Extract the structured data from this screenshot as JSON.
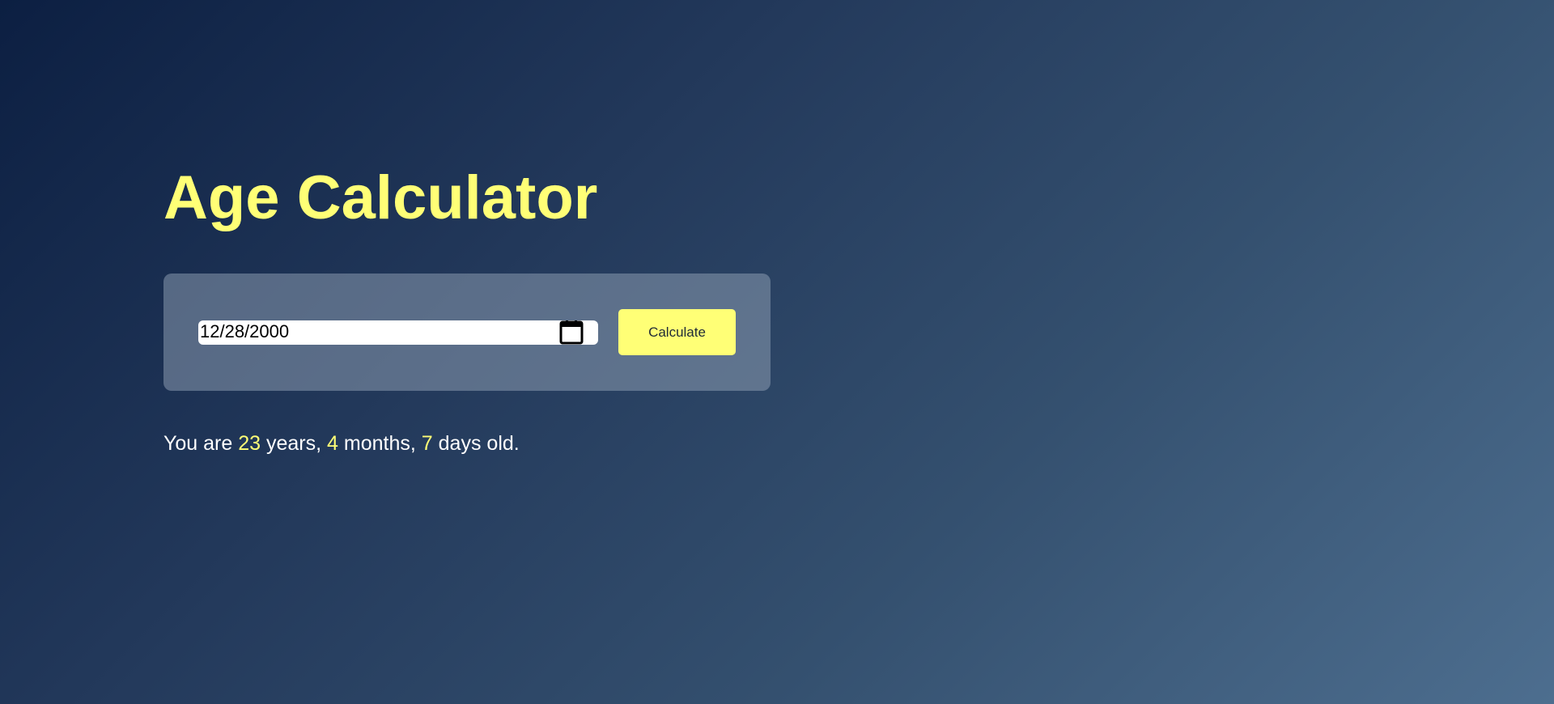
{
  "app": {
    "title": "Age Calculator"
  },
  "form": {
    "date_value": "12/28/2000",
    "button_label": "Calculate",
    "calendar_icon": "calendar-icon"
  },
  "result": {
    "prefix": "You are",
    "years": "23",
    "years_label": "years,",
    "months": "4",
    "months_label": "months,",
    "days": "7",
    "days_label": "days old."
  },
  "colors": {
    "accent": "#ffff76",
    "background_start": "#0c1f42",
    "background_end": "#4d6e8f",
    "card": "#94a3b8",
    "text": "#ffffff"
  }
}
